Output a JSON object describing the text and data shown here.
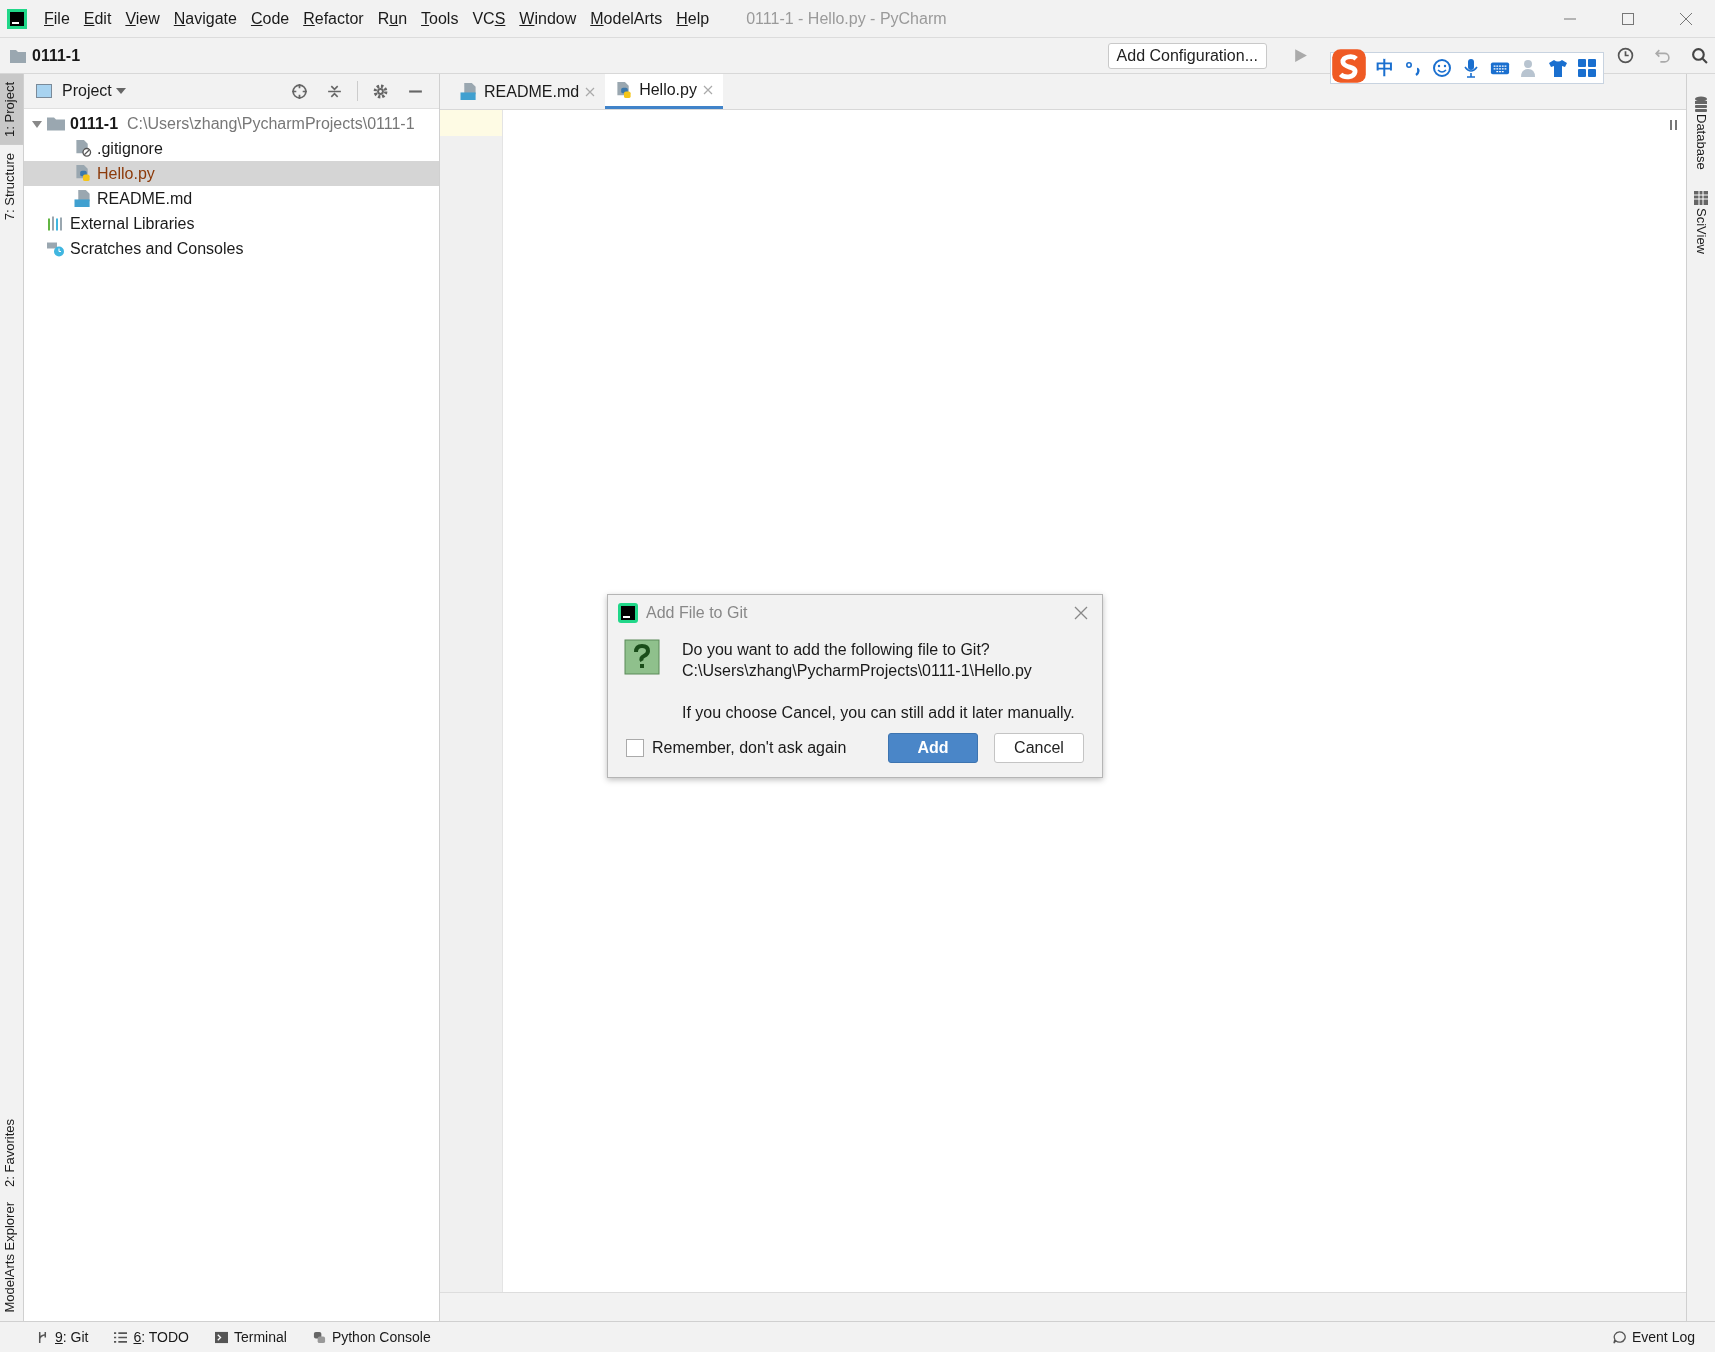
{
  "window": {
    "title": "0111-1 - Hello.py - PyCharm"
  },
  "menu": [
    {
      "key": "F",
      "post": "ile"
    },
    {
      "key": "E",
      "post": "dit"
    },
    {
      "key": "V",
      "post": "iew"
    },
    {
      "key": "N",
      "post": "avigate"
    },
    {
      "key": "C",
      "post": "ode"
    },
    {
      "key": "R",
      "post": "efactor"
    },
    {
      "pre": "R",
      "key": "u",
      "post": "n"
    },
    {
      "key": "T",
      "post": "ools"
    },
    {
      "pre": "VC",
      "key": "S"
    },
    {
      "key": "W",
      "post": "indow"
    },
    {
      "key": "M",
      "post": "odelArts"
    },
    {
      "key": "H",
      "post": "elp"
    }
  ],
  "breadcrumb": "0111-1",
  "toolbar": {
    "config_button": "Add Configuration..."
  },
  "ime_bar": {
    "mode": "中"
  },
  "left_strip": [
    {
      "label": "1: Project",
      "selected": true
    },
    {
      "label": "7: Structure",
      "selected": false
    },
    {
      "label": "2: Favorites",
      "selected": false
    },
    {
      "label": "ModelArts Explorer",
      "selected": false
    }
  ],
  "project_panel": {
    "title": "Project",
    "tree": [
      {
        "kind": "folder",
        "name": "0111-1",
        "path": "C:\\Users\\zhang\\PycharmProjects\\0111-1",
        "expanded": true,
        "selected": false,
        "unversioned": false,
        "children": [
          {
            "kind": "gitignore",
            "name": ".gitignore",
            "selected": false,
            "unversioned": false
          },
          {
            "kind": "python",
            "name": "Hello.py",
            "selected": true,
            "unversioned": true
          },
          {
            "kind": "markdown",
            "name": "README.md",
            "selected": false,
            "unversioned": false
          }
        ]
      },
      {
        "kind": "libraries",
        "name": "External Libraries",
        "selected": false,
        "unversioned": false
      },
      {
        "kind": "scratches",
        "name": "Scratches and Consoles",
        "selected": false,
        "unversioned": false
      }
    ]
  },
  "tabs": [
    {
      "kind": "markdown",
      "label": "README.md",
      "selected": false
    },
    {
      "kind": "python",
      "label": "Hello.py",
      "selected": true
    }
  ],
  "right_strip": [
    "Database",
    "SciView"
  ],
  "dialog": {
    "title": "Add File to Git",
    "question": "Do you want to add the following file to Git?",
    "path": "C:\\Users\\zhang\\PycharmProjects\\0111-1\\Hello.py",
    "note": "If you choose Cancel, you can still add it later manually.",
    "checkbox": {
      "label": "Remember, don't ask again",
      "checked": false
    },
    "buttons": [
      {
        "label": "Add",
        "default": true
      },
      {
        "label": "Cancel",
        "default": false
      }
    ]
  },
  "status_bar": {
    "tools": [
      {
        "kind": "git",
        "key": "9",
        "post": ": Git"
      },
      {
        "kind": "todo",
        "key": "6",
        "post": ": TODO"
      },
      {
        "kind": "terminal",
        "post": "Terminal"
      },
      {
        "kind": "python",
        "post": "Python Console"
      }
    ],
    "event_log": "Event Log"
  }
}
